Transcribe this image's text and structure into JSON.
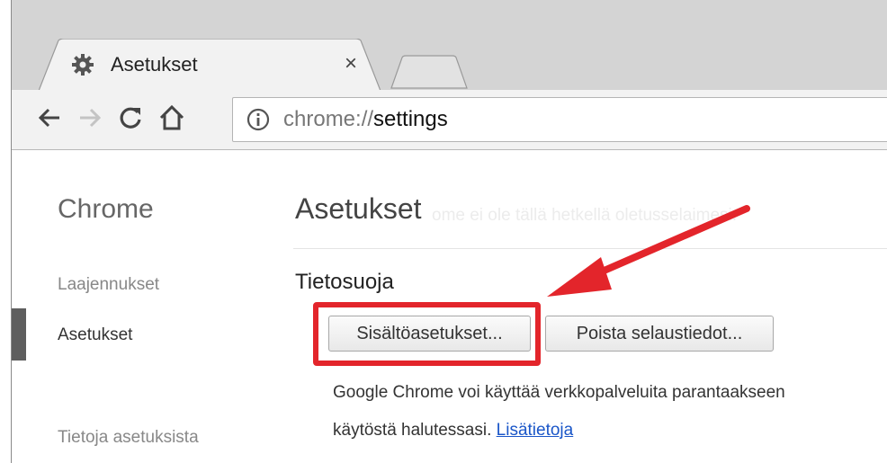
{
  "browser": {
    "tab": {
      "title": "Asetukset",
      "icon": "gear-icon",
      "close_label": "×"
    },
    "toolbar": {
      "back_icon": "back-arrow-icon",
      "forward_icon": "forward-arrow-icon",
      "reload_icon": "reload-icon",
      "home_icon": "home-icon",
      "url_scheme": "chrome://",
      "url_path": "settings"
    }
  },
  "sidebar": {
    "title": "Chrome",
    "items": [
      {
        "label": "Laajennukset"
      },
      {
        "label": "Asetukset"
      },
      {
        "label": "Tietoja asetuksista"
      }
    ]
  },
  "main": {
    "title": "Asetukset",
    "faded_text": "ome ei ole tällä hetkellä oletusselaimesi.",
    "section_title": "Tietosuoja",
    "buttons": {
      "content_settings": "Sisältöasetukset...",
      "clear_browsing": "Poista selaustiedot..."
    },
    "description_line1": "Google Chrome voi käyttää verkkopalveluita parantaakseen",
    "description_line2": "käytöstä halutessasi.",
    "learn_more": "Lisätietoja"
  },
  "colors": {
    "annotation_red": "#e3252b",
    "link_blue": "#1a56c8"
  }
}
